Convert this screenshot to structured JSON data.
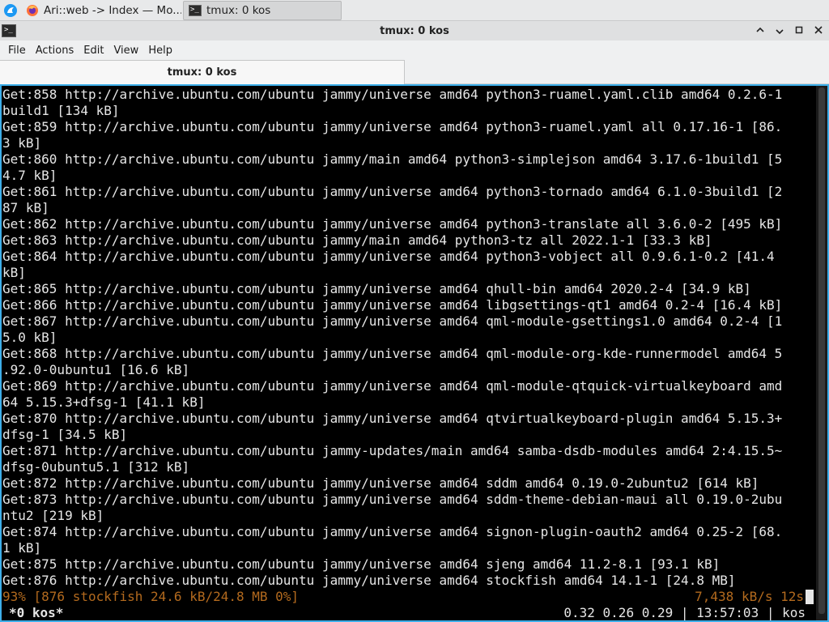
{
  "taskbar": {
    "tasks": [
      {
        "label": "Ari::web -> Index — Mo...",
        "icon": "firefox-icon",
        "active": false
      },
      {
        "label": "tmux: 0 kos",
        "icon": "terminal-icon",
        "active": true
      }
    ]
  },
  "window": {
    "title": "tmux: 0 kos"
  },
  "menu": {
    "file": "File",
    "actions": "Actions",
    "edit": "Edit",
    "view": "View",
    "help": "Help"
  },
  "tab": {
    "label": "tmux: 0 kos"
  },
  "terminal": {
    "lines": [
      "Get:858 http://archive.ubuntu.com/ubuntu jammy/universe amd64 python3-ruamel.yaml.clib amd64 0.2.6-1",
      "build1 [134 kB]",
      "Get:859 http://archive.ubuntu.com/ubuntu jammy/universe amd64 python3-ruamel.yaml all 0.17.16-1 [86.",
      "3 kB]",
      "Get:860 http://archive.ubuntu.com/ubuntu jammy/main amd64 python3-simplejson amd64 3.17.6-1build1 [5",
      "4.7 kB]",
      "Get:861 http://archive.ubuntu.com/ubuntu jammy/universe amd64 python3-tornado amd64 6.1.0-3build1 [2",
      "87 kB]",
      "Get:862 http://archive.ubuntu.com/ubuntu jammy/universe amd64 python3-translate all 3.6.0-2 [495 kB]",
      "Get:863 http://archive.ubuntu.com/ubuntu jammy/main amd64 python3-tz all 2022.1-1 [33.3 kB]",
      "Get:864 http://archive.ubuntu.com/ubuntu jammy/universe amd64 python3-vobject all 0.9.6.1-0.2 [41.4",
      "kB]",
      "Get:865 http://archive.ubuntu.com/ubuntu jammy/universe amd64 qhull-bin amd64 2020.2-4 [34.9 kB]",
      "Get:866 http://archive.ubuntu.com/ubuntu jammy/universe amd64 libgsettings-qt1 amd64 0.2-4 [16.4 kB]",
      "Get:867 http://archive.ubuntu.com/ubuntu jammy/universe amd64 qml-module-gsettings1.0 amd64 0.2-4 [1",
      "5.0 kB]",
      "Get:868 http://archive.ubuntu.com/ubuntu jammy/universe amd64 qml-module-org-kde-runnermodel amd64 5",
      ".92.0-0ubuntu1 [16.6 kB]",
      "Get:869 http://archive.ubuntu.com/ubuntu jammy/universe amd64 qml-module-qtquick-virtualkeyboard amd",
      "64 5.15.3+dfsg-1 [41.1 kB]",
      "Get:870 http://archive.ubuntu.com/ubuntu jammy/universe amd64 qtvirtualkeyboard-plugin amd64 5.15.3+",
      "dfsg-1 [34.5 kB]",
      "Get:871 http://archive.ubuntu.com/ubuntu jammy-updates/main amd64 samba-dsdb-modules amd64 2:4.15.5~",
      "dfsg-0ubuntu5.1 [312 kB]",
      "Get:872 http://archive.ubuntu.com/ubuntu jammy/universe amd64 sddm amd64 0.19.0-2ubuntu2 [614 kB]",
      "Get:873 http://archive.ubuntu.com/ubuntu jammy/universe amd64 sddm-theme-debian-maui all 0.19.0-2ubu",
      "ntu2 [219 kB]",
      "Get:874 http://archive.ubuntu.com/ubuntu jammy/universe amd64 signon-plugin-oauth2 amd64 0.25-2 [68.",
      "1 kB]",
      "Get:875 http://archive.ubuntu.com/ubuntu jammy/universe amd64 sjeng amd64 11.2-8.1 [93.1 kB]",
      "Get:876 http://archive.ubuntu.com/ubuntu jammy/universe amd64 stockfish amd64 14.1-1 [24.8 MB]"
    ],
    "progress_left": "93% [876 stockfish 24.6 kB/24.8 MB 0%]",
    "progress_right": "7,438 kB/s 12s",
    "progress_color": "#b36a1e"
  },
  "tmux_status": {
    "window": "*0 kos*",
    "right": "0.32 0.26 0.29 | 13:57:03 | kos"
  },
  "colors": {
    "focus_border": "#3daee9",
    "terminal_bg": "#000000",
    "terminal_fg": "#e6e6e6"
  }
}
